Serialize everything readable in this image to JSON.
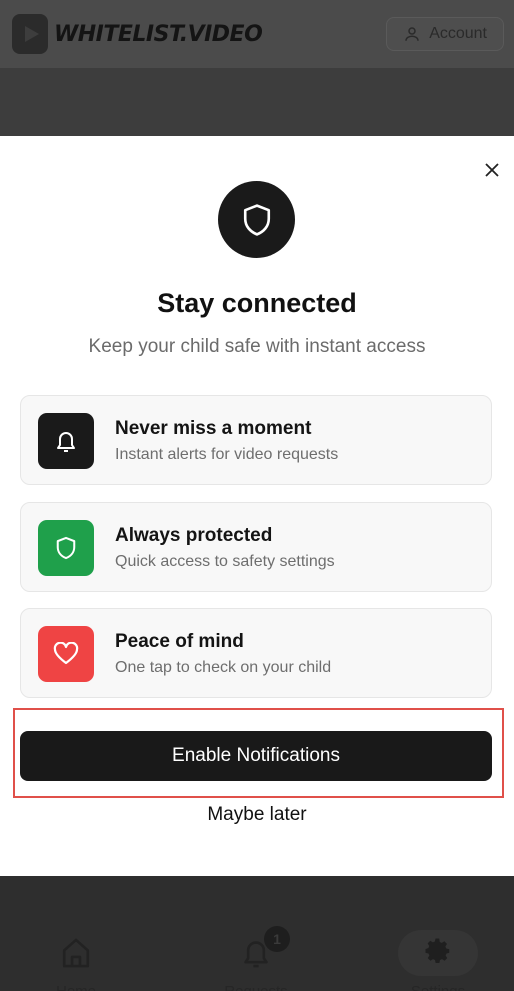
{
  "header": {
    "logo_text": "WHITELIST.VIDEO",
    "account_label": "Account"
  },
  "modal": {
    "title": "Stay connected",
    "subtitle": "Keep your child safe with instant access",
    "features": [
      {
        "title": "Never miss a moment",
        "subtitle": "Instant alerts for video requests",
        "icon": "bell-icon",
        "color": "#1a1a1a"
      },
      {
        "title": "Always protected",
        "subtitle": "Quick access to safety settings",
        "icon": "shield-icon",
        "color": "#1fa04b"
      },
      {
        "title": "Peace of mind",
        "subtitle": "One tap to check on your child",
        "icon": "heart-icon",
        "color": "#ef4444"
      }
    ],
    "primary_button": "Enable Notifications",
    "secondary_button": "Maybe later"
  },
  "bottom_nav": {
    "items": [
      {
        "label": "Home"
      },
      {
        "label": "Requests"
      },
      {
        "label": "Settings"
      }
    ],
    "requests_badge": "1"
  }
}
